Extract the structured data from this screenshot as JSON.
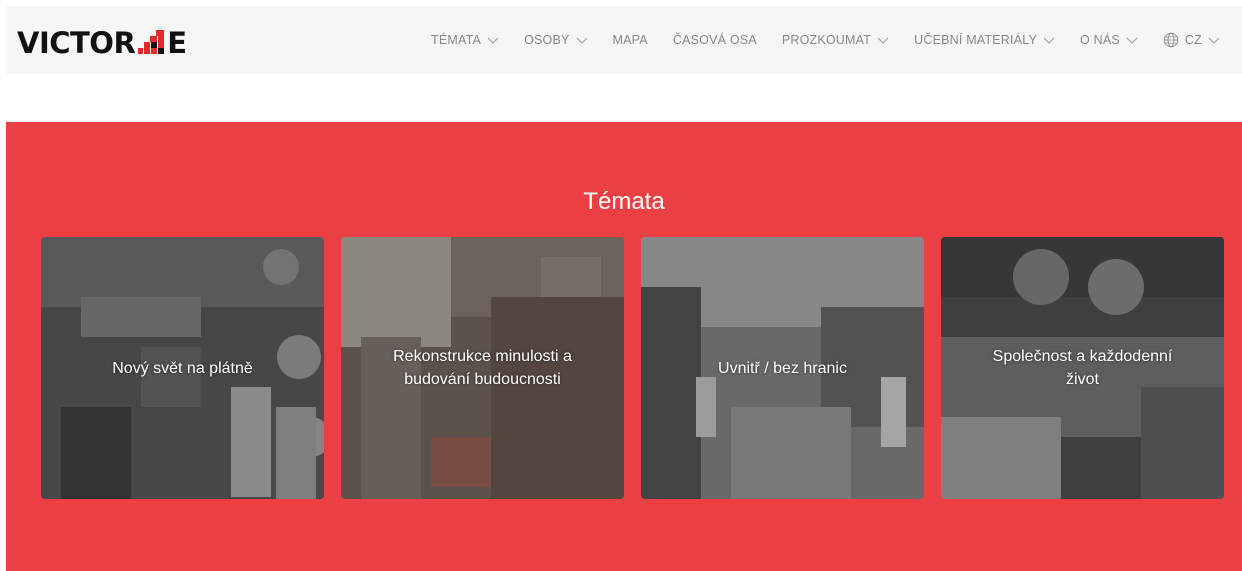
{
  "header": {
    "logo": {
      "text_left": "VICTOR",
      "text_right": "E",
      "accent": "#e32b2b"
    },
    "nav": [
      {
        "label": "TÉMATA",
        "dropdown": true
      },
      {
        "label": "OSOBY",
        "dropdown": true
      },
      {
        "label": "MAPA",
        "dropdown": false
      },
      {
        "label": "ČASOVÁ OSA",
        "dropdown": false
      },
      {
        "label": "PROZKOUMAT",
        "dropdown": true
      },
      {
        "label": "UČEBNÍ MATERIÁLY",
        "dropdown": true
      },
      {
        "label": "O NÁS",
        "dropdown": true
      }
    ],
    "language": {
      "label": "CZ",
      "icon": "globe-icon"
    }
  },
  "main": {
    "title": "Témata",
    "background": "#ea3f43",
    "cards": [
      {
        "label": "Nový svět na plátně"
      },
      {
        "label": "Rekonstrukce minulosti a budování budoucnosti"
      },
      {
        "label": "Uvnitř / bez hranic"
      },
      {
        "label": "Společnost a každodenní život"
      }
    ]
  }
}
